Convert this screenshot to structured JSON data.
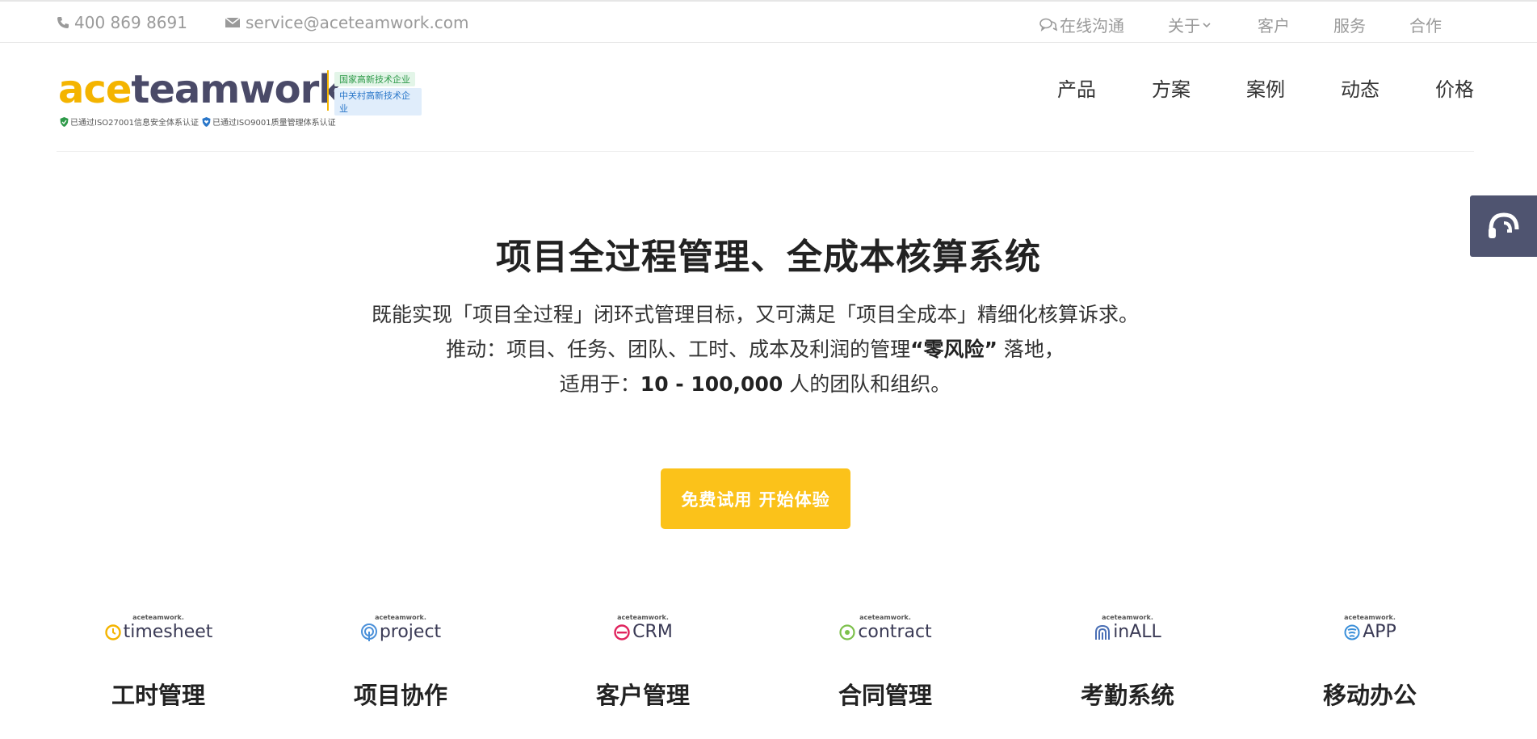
{
  "topbar": {
    "phone": "400 869 8691",
    "email": "service@aceteamwork.com",
    "chat": "在线沟通",
    "about": "关于",
    "customers": "客户",
    "services": "服务",
    "partners": "合作"
  },
  "logo": {
    "ace": "ace",
    "teamwork": "teamwork",
    "reg": "®",
    "badge1": "国家高新技术企业",
    "badge2": "中关村高新技术企业",
    "cert1": "已通过ISO27001信息安全体系认证",
    "cert2": "已通过ISO9001质量管理体系认证"
  },
  "nav": [
    "产品",
    "方案",
    "案例",
    "动态",
    "价格"
  ],
  "hero": {
    "title": "项目全过程管理、全成本核算系统",
    "line1": "既能实现「项目全过程」闭环式管理目标，又可满足「项目全成本」精细化核算诉求。",
    "line2_pre": "推动：项目、任务、团队、工时、成本及利润的管理",
    "line2_bold": "“零风险”",
    "line2_post": " 落地，",
    "line3_pre": "适用于：",
    "line3_bold": "10 - 100,000",
    "line3_post": " 人的团队和组织。",
    "cta": "免费试用 开始体验"
  },
  "products": [
    {
      "brand": "aceteamwork.",
      "name": "timesheet",
      "cn": "工时管理",
      "color": "#f4b400"
    },
    {
      "brand": "aceteamwork.",
      "name": "project",
      "cn": "项目协作",
      "color": "#4a90d9"
    },
    {
      "brand": "aceteamwork.",
      "name": "CRM",
      "cn": "客户管理",
      "color": "#e0245e"
    },
    {
      "brand": "aceteamwork.",
      "name": "contract",
      "cn": "合同管理",
      "color": "#7cc04b"
    },
    {
      "brand": "aceteamwork.",
      "name": "inALL",
      "cn": "考勤系统",
      "color": "#4a6fb5"
    },
    {
      "brand": "aceteamwork.",
      "name": "APP",
      "cn": "移动办公",
      "color": "#3a8fd9"
    }
  ]
}
